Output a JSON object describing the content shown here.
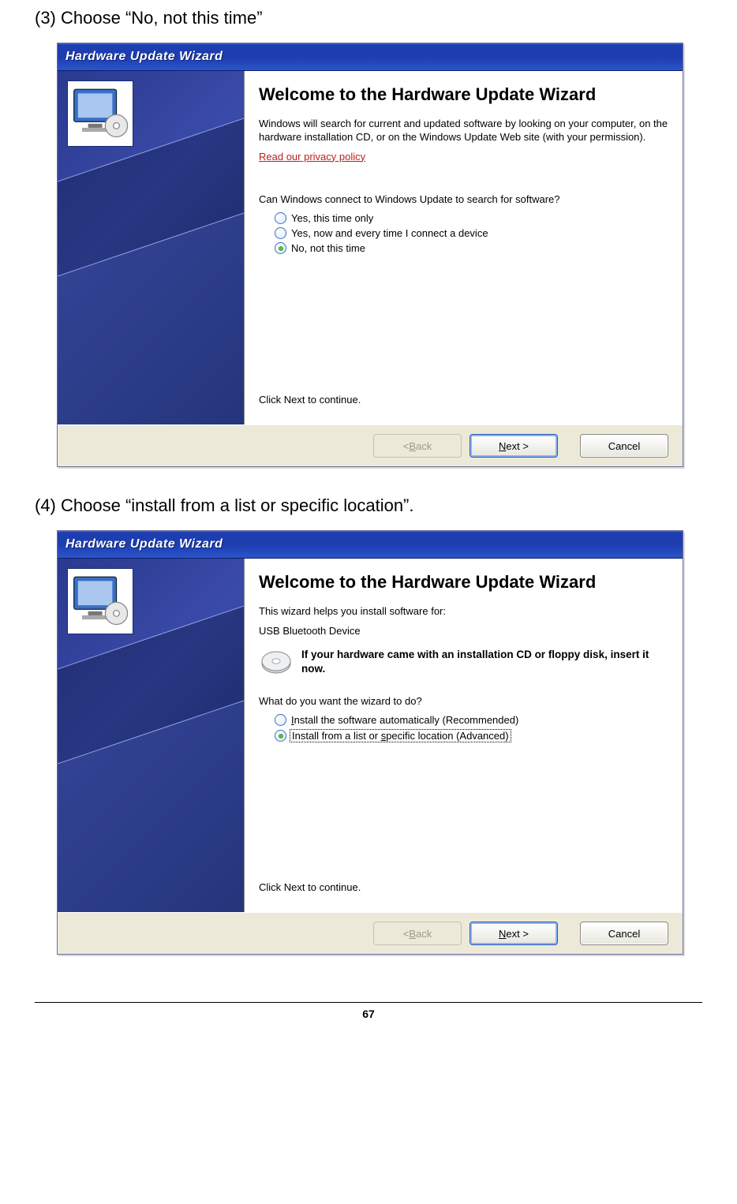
{
  "page": {
    "number": "67",
    "instruction3": "(3) Choose “No, not this time”",
    "instruction4": "(4) Choose “install from a list or specific location”."
  },
  "wizard1": {
    "title": "Hardware Update Wizard",
    "heading": "Welcome to the Hardware Update Wizard",
    "intro": "Windows will search for current and updated software by looking on your computer, on the hardware installation CD, or on the Windows Update Web site (with your permission).",
    "privacy": "Read our privacy policy",
    "question": "Can Windows connect to Windows Update to search for software?",
    "options": {
      "opt1": "Yes, this time only",
      "opt2": "Yes, now and every time I connect a device",
      "opt3": "No, not this time"
    },
    "continue": "Click Next to continue.",
    "buttons": {
      "back_pre": "< ",
      "back_u": "B",
      "back_post": "ack",
      "next_u": "N",
      "next_post": "ext >",
      "cancel": "Cancel"
    }
  },
  "wizard2": {
    "title": "Hardware Update Wizard",
    "heading": "Welcome to the Hardware Update Wizard",
    "intro": "This wizard helps you install software for:",
    "device": "USB Bluetooth Device",
    "insert": "If your hardware came with an installation CD or floppy disk, insert it now.",
    "question": "What do you want the wizard to do?",
    "options": {
      "opt1_pre": "",
      "opt1_u": "I",
      "opt1_post": "nstall the software automatically (Recommended)",
      "opt2_pre": "Install from a list or ",
      "opt2_u": "s",
      "opt2_post": "pecific location (Advanced)"
    },
    "continue": "Click Next to continue.",
    "buttons": {
      "back_pre": "< ",
      "back_u": "B",
      "back_post": "ack",
      "next_u": "N",
      "next_post": "ext >",
      "cancel": "Cancel"
    }
  }
}
